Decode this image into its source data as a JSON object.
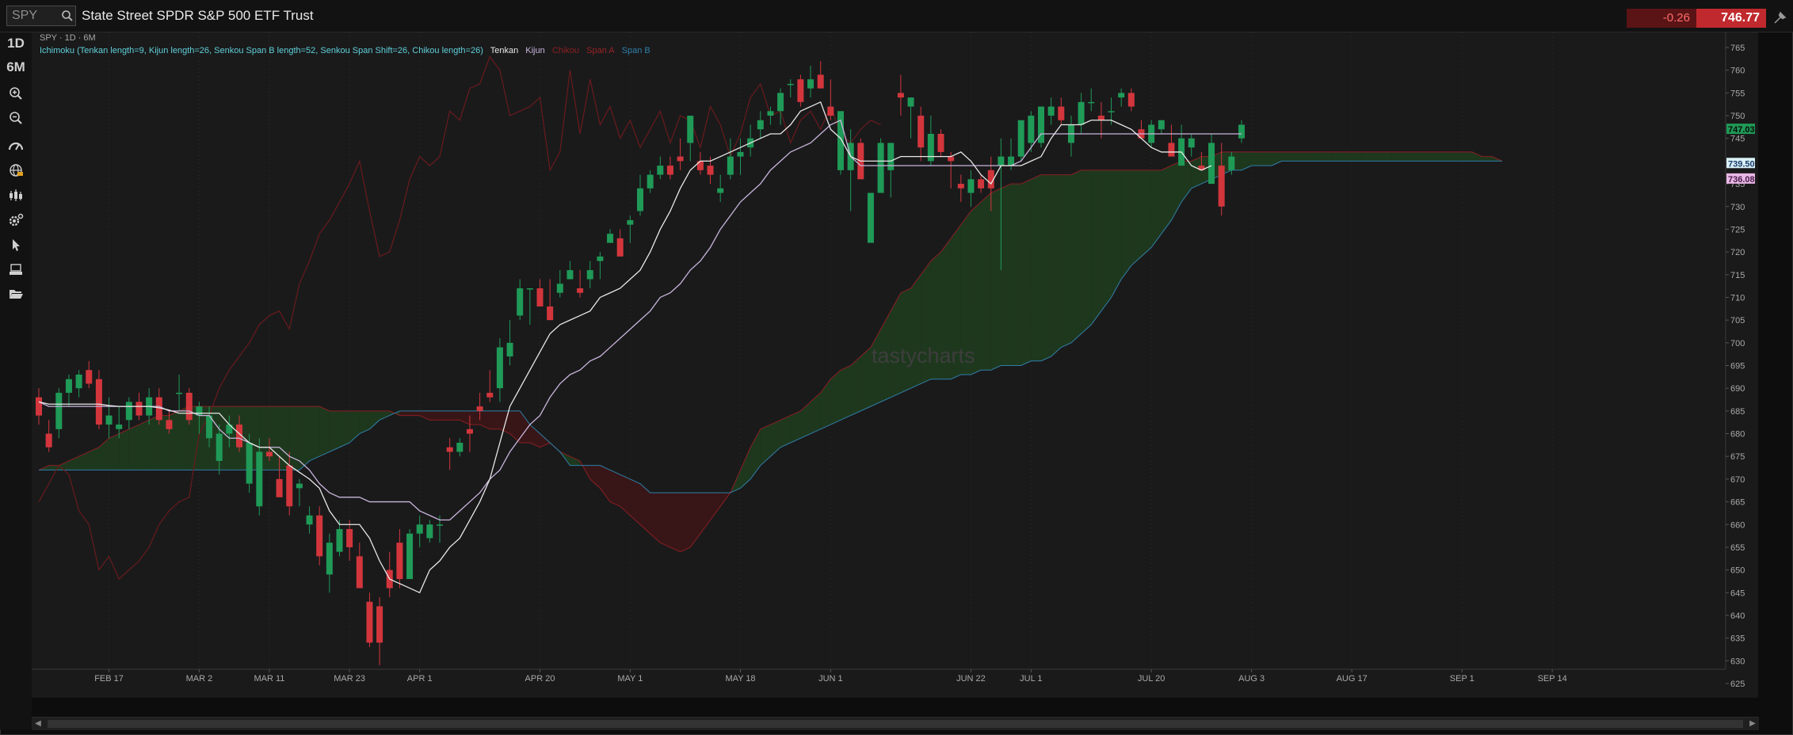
{
  "header": {
    "symbol_value": "SPY",
    "instrument_name": "State Street SPDR S&P 500 ETF Trust",
    "change": "-0.26",
    "last_price": "746.77",
    "search_icon": "search-icon",
    "pin_icon": "pin-icon"
  },
  "toolbar": {
    "interval": "1D",
    "range": "6M",
    "icons": [
      "zoom-in-icon",
      "zoom-out-icon",
      "speedometer-icon",
      "globe-icon",
      "candlestick-type-icon",
      "settings-icon",
      "cursor-icon",
      "drawing-tool-icon",
      "folder-open-icon"
    ]
  },
  "chart_info": "SPY · 1D · 6M",
  "legend": {
    "study": "Ichimoku (Tenkan length=9, Kijun length=26, Senkou Span B length=52, Senkou Span Shift=26, Chikou length=26)",
    "tenkan": "Tenkan",
    "kijun": "Kijun",
    "chikou": "Chikou",
    "span_a": "Span A",
    "span_b": "Span B"
  },
  "watermark": "tastycharts",
  "colors": {
    "up": "#1f9a57",
    "down": "#d2363c",
    "tenkan": "#e8e8e8",
    "kijun": "#c9b5dc",
    "chikou": "#6a1a1c",
    "span_a": "#8b1e22",
    "span_b": "#2f7fa8",
    "cloud_bull": "#1f3a1f",
    "cloud_bear": "#3a1617",
    "legend_study": "#5fd0d8"
  },
  "chart_data": {
    "type": "candlestick",
    "title": "SPY",
    "ylim": [
      622,
      767
    ],
    "y_ticks": [
      625,
      630,
      635,
      640,
      645,
      650,
      655,
      660,
      665,
      670,
      675,
      680,
      685,
      690,
      695,
      700,
      705,
      710,
      715,
      720,
      725,
      730,
      735,
      740,
      745,
      750,
      755,
      760,
      765
    ],
    "x_ticks": [
      {
        "label": "FEB 17",
        "index": 7
      },
      {
        "label": "MAR 2",
        "index": 16
      },
      {
        "label": "MAR 11",
        "index": 23
      },
      {
        "label": "MAR 23",
        "index": 31
      },
      {
        "label": "APR 1",
        "index": 38
      },
      {
        "label": "APR 20",
        "index": 50
      },
      {
        "label": "MAY 1",
        "index": 59
      },
      {
        "label": "MAY 18",
        "index": 70
      },
      {
        "label": "JUN 1",
        "index": 79
      },
      {
        "label": "JUN 22",
        "index": 93
      },
      {
        "label": "JUL 1",
        "index": 99
      },
      {
        "label": "JUL 20",
        "index": 111
      },
      {
        "label": "AUG 3",
        "index": 121
      },
      {
        "label": "AUG 17",
        "index": 131
      },
      {
        "label": "SEP 1",
        "index": 142
      },
      {
        "label": "SEP 14",
        "index": 151
      }
    ],
    "axis_badges": [
      {
        "value": "747.03",
        "price": 747.03,
        "color": "#1f9a57",
        "text_color": "#0a0a0a"
      },
      {
        "value": "739.50",
        "price": 739.5,
        "color": "#d9f0f5",
        "text_color": "#1a3c6a"
      },
      {
        "value": "736.08",
        "price": 736.08,
        "color": "#e9b8e6",
        "text_color": "#4a1a4a"
      }
    ],
    "candles": [
      [
        688,
        690,
        682,
        684
      ],
      [
        680,
        683,
        676,
        677
      ],
      [
        681,
        690,
        679,
        689
      ],
      [
        689,
        693,
        686,
        692
      ],
      [
        690,
        694,
        688,
        693
      ],
      [
        694,
        696,
        690,
        691
      ],
      [
        692,
        694,
        681,
        682
      ],
      [
        682,
        688,
        679,
        684
      ],
      [
        681,
        686,
        679,
        682
      ],
      [
        683,
        688,
        681,
        687
      ],
      [
        687,
        689,
        683,
        684
      ],
      [
        684,
        690,
        682,
        688
      ],
      [
        688,
        690,
        682,
        683
      ],
      [
        683,
        685,
        680,
        681
      ],
      [
        689,
        693,
        685,
        689
      ],
      [
        689,
        690,
        682,
        683
      ],
      [
        684,
        687,
        680,
        686
      ],
      [
        679,
        686,
        677,
        684
      ],
      [
        674,
        682,
        671,
        680
      ],
      [
        680,
        684,
        677,
        682
      ],
      [
        682,
        684,
        676,
        677
      ],
      [
        669,
        680,
        667,
        678
      ],
      [
        664,
        679,
        662,
        676
      ],
      [
        676,
        679,
        674,
        675
      ],
      [
        670,
        675,
        668,
        666
      ],
      [
        673,
        676,
        662,
        664
      ],
      [
        668,
        670,
        664,
        669
      ],
      [
        660,
        664,
        658,
        662
      ],
      [
        662,
        664,
        651,
        653
      ],
      [
        649,
        658,
        645,
        656
      ],
      [
        654,
        661,
        653,
        659
      ],
      [
        659,
        661,
        652,
        655
      ],
      [
        653,
        656,
        646,
        646
      ],
      [
        643,
        645,
        633,
        634
      ],
      [
        642,
        644,
        629,
        634
      ],
      [
        650,
        654,
        644,
        646
      ],
      [
        656,
        659,
        646,
        648
      ],
      [
        648,
        659,
        648,
        658
      ],
      [
        658,
        662,
        655,
        660
      ],
      [
        657,
        661,
        656,
        660
      ],
      [
        660,
        662,
        656,
        660
      ],
      [
        677,
        679,
        672,
        676
      ],
      [
        676,
        679,
        675,
        678
      ],
      [
        681,
        684,
        676,
        680
      ],
      [
        686,
        689,
        683,
        685
      ],
      [
        689,
        694,
        687,
        688
      ],
      [
        690,
        701,
        687,
        699
      ],
      [
        697,
        705,
        695,
        700
      ],
      [
        706,
        714,
        705,
        712
      ],
      [
        712,
        712,
        704,
        712
      ],
      [
        712,
        714,
        708,
        708
      ],
      [
        708,
        714,
        705,
        705
      ],
      [
        711,
        716,
        710,
        713
      ],
      [
        714,
        718,
        714,
        716
      ],
      [
        712,
        716,
        710,
        711
      ],
      [
        714,
        718,
        712,
        716
      ],
      [
        718,
        720,
        714,
        719
      ],
      [
        722,
        725,
        722,
        724
      ],
      [
        723,
        725,
        720,
        719
      ],
      [
        726,
        728,
        722,
        727
      ],
      [
        729,
        737,
        728,
        734
      ],
      [
        734,
        738,
        733,
        737
      ],
      [
        737,
        741,
        736,
        739
      ],
      [
        739,
        741,
        736,
        737
      ],
      [
        741,
        745,
        738,
        740
      ],
      [
        744,
        750,
        740,
        750
      ],
      [
        740,
        742,
        737,
        738
      ],
      [
        739,
        741,
        735,
        737
      ],
      [
        733,
        737,
        731,
        734
      ],
      [
        737,
        745,
        736,
        741
      ],
      [
        741,
        745,
        737,
        742
      ],
      [
        743,
        748,
        741,
        745
      ],
      [
        747,
        751,
        745,
        749
      ],
      [
        750,
        752,
        748,
        751
      ],
      [
        751,
        756,
        748,
        755
      ],
      [
        757,
        758,
        754,
        757
      ],
      [
        758,
        759,
        752,
        753
      ],
      [
        756,
        761,
        754,
        758
      ],
      [
        759,
        762,
        756,
        756
      ],
      [
        752,
        758,
        749,
        750
      ],
      [
        738,
        750,
        737,
        751
      ],
      [
        738,
        747,
        729,
        744
      ],
      [
        744,
        745,
        738,
        736
      ],
      [
        722,
        733,
        726,
        733
      ],
      [
        733,
        745,
        735,
        744
      ],
      [
        738,
        744,
        732,
        744
      ],
      [
        755,
        759,
        750,
        754
      ],
      [
        752,
        754,
        745,
        754
      ],
      [
        750,
        752,
        740,
        743
      ],
      [
        740,
        750,
        739,
        746
      ],
      [
        746,
        747,
        741,
        742
      ],
      [
        741,
        742,
        734,
        740
      ],
      [
        735,
        737,
        731,
        734
      ],
      [
        733,
        738,
        730,
        736
      ],
      [
        736,
        737,
        733,
        734
      ],
      [
        738,
        741,
        729,
        734
      ],
      [
        739,
        745,
        716,
        741
      ],
      [
        739,
        745,
        738,
        741
      ],
      [
        741,
        749,
        740,
        749
      ],
      [
        744,
        751,
        742,
        750
      ],
      [
        744,
        752,
        743,
        752
      ],
      [
        750,
        754,
        748,
        752
      ],
      [
        752,
        754,
        748,
        749
      ],
      [
        744,
        750,
        741,
        748
      ],
      [
        748,
        755,
        746,
        753
      ],
      [
        753,
        756,
        751,
        753
      ],
      [
        750,
        753,
        745,
        749
      ],
      [
        751,
        754,
        748,
        751
      ],
      [
        754,
        756,
        752,
        755
      ],
      [
        755,
        756,
        751,
        752
      ],
      [
        747,
        749,
        745,
        745
      ],
      [
        744,
        749,
        743,
        748
      ],
      [
        747,
        749,
        746,
        749
      ],
      [
        744,
        748,
        743,
        741
      ],
      [
        739,
        748,
        741,
        745
      ],
      [
        743,
        746,
        741,
        745
      ],
      [
        739,
        742,
        738,
        738
      ],
      [
        735,
        746,
        735,
        744
      ],
      [
        739,
        744,
        728,
        730
      ],
      [
        738,
        742,
        737,
        741
      ],
      [
        745,
        749,
        744,
        748
      ]
    ],
    "tenkan": [
      687,
      686.5,
      686.5,
      686.5,
      686.5,
      686.5,
      686.5,
      686.2,
      686,
      686,
      686,
      686,
      685.7,
      685.2,
      684.5,
      684.5,
      684.5,
      684.5,
      684.5,
      682,
      680,
      678,
      677,
      677,
      675,
      673,
      671.5,
      670,
      668,
      663,
      660,
      660,
      660,
      657,
      652,
      648,
      647,
      646,
      645,
      650,
      652,
      655,
      657,
      661,
      665,
      670,
      678,
      686,
      690,
      694,
      698,
      702,
      704,
      705,
      706,
      707,
      710,
      711,
      712,
      714,
      716,
      720,
      725,
      729,
      734,
      738,
      740,
      740,
      741,
      742,
      743,
      744,
      745,
      746,
      746,
      748,
      751,
      752,
      753,
      747,
      745,
      741,
      740,
      740,
      740,
      740,
      741,
      741,
      741,
      741,
      741,
      741,
      742,
      740,
      737,
      735,
      739,
      739,
      739,
      740,
      741,
      745,
      748,
      748,
      748,
      749,
      749,
      749,
      748,
      747,
      745,
      743,
      742,
      742,
      742,
      739,
      738,
      739
    ],
    "kijun": [
      687,
      686,
      686,
      686,
      686,
      686,
      686,
      686,
      686,
      686,
      686,
      686,
      686,
      685,
      685,
      685,
      684,
      684,
      681,
      679,
      679,
      678,
      677,
      677,
      677,
      675,
      674,
      672,
      669,
      667,
      666,
      666,
      666,
      665,
      665,
      665,
      665,
      665,
      663,
      662,
      661,
      661,
      663,
      665,
      667,
      670,
      672,
      676,
      679,
      682,
      684,
      688,
      691,
      693,
      694,
      696,
      697,
      699,
      701,
      703,
      705,
      707,
      710,
      711,
      713,
      716,
      718,
      721,
      725,
      728,
      731,
      733,
      735,
      738,
      740,
      742,
      743,
      744,
      746,
      748,
      749,
      741,
      739,
      739,
      739,
      739,
      739,
      739,
      739,
      739,
      739,
      739,
      739,
      739,
      739,
      739,
      739,
      739,
      740,
      743,
      746,
      746,
      746,
      746,
      746,
      746,
      746,
      746,
      746,
      746,
      746,
      746,
      746,
      746,
      746,
      746,
      746,
      746,
      746,
      746,
      746
    ],
    "chikou": [
      665,
      669,
      673,
      671,
      663,
      660,
      650,
      653,
      648,
      650,
      652,
      655,
      660,
      663,
      665,
      666,
      680,
      684,
      690,
      694,
      697,
      700,
      704,
      706,
      707,
      703,
      713,
      718,
      724,
      727,
      731,
      735,
      740,
      729,
      719,
      720,
      727,
      736,
      741,
      739,
      741,
      751,
      749,
      756,
      757,
      763,
      760,
      750,
      751,
      752,
      754,
      738,
      742,
      760,
      746,
      758,
      748,
      752,
      745,
      749,
      743,
      747,
      751,
      744,
      750,
      749,
      743,
      752,
      748,
      741,
      746,
      754,
      757,
      750,
      751,
      744,
      749,
      751,
      747,
      752,
      746,
      744,
      747,
      749,
      748
    ],
    "span_a": [
      672,
      673,
      673,
      674,
      675,
      676,
      677,
      679,
      680,
      681,
      682,
      683,
      684,
      684,
      685,
      686,
      686,
      686,
      686,
      686,
      686,
      686,
      686,
      686,
      686,
      686,
      686,
      686,
      686,
      685,
      685,
      685,
      685,
      685,
      685,
      685,
      684,
      684,
      684,
      683,
      683,
      683,
      683,
      682,
      682,
      681,
      681,
      680,
      678,
      678,
      677,
      678,
      676,
      675,
      674,
      670,
      668,
      665,
      664,
      662,
      660,
      658,
      656,
      655,
      654,
      655,
      658,
      661,
      664,
      667,
      672,
      677,
      681,
      682,
      683,
      684,
      685,
      687,
      689,
      692,
      694,
      695,
      697,
      699,
      703,
      707,
      711,
      712,
      715,
      718,
      720,
      723,
      726,
      729,
      731,
      733,
      734,
      735,
      735,
      736,
      737,
      737,
      737,
      737,
      738,
      738,
      738,
      738,
      738,
      738,
      738,
      738,
      738,
      739,
      740,
      740,
      741,
      741,
      742,
      742,
      742,
      742,
      742,
      742,
      742,
      742,
      742,
      742,
      742,
      742,
      742,
      742,
      742,
      742,
      742,
      742,
      742,
      742,
      742,
      742,
      742,
      742,
      742,
      742,
      741,
      741,
      740
    ],
    "span_b": [
      672,
      672,
      672,
      672,
      672,
      672,
      672,
      672,
      672,
      672,
      672,
      672,
      672,
      672,
      672,
      672,
      672,
      672,
      672,
      672,
      672,
      672,
      672,
      672,
      672,
      672,
      672,
      674,
      675,
      676,
      677,
      678,
      680,
      681,
      683,
      684,
      685,
      685,
      685,
      685,
      685,
      685,
      685,
      685,
      685,
      685,
      685,
      685,
      685,
      682,
      680,
      678,
      676,
      673,
      673,
      673,
      673,
      672,
      671,
      670,
      669,
      667,
      667,
      667,
      667,
      667,
      667,
      667,
      667,
      667,
      668,
      670,
      673,
      675,
      677,
      678,
      679,
      680,
      681,
      682,
      683,
      684,
      685,
      686,
      687,
      688,
      689,
      690,
      691,
      692,
      692,
      692,
      693,
      693,
      694,
      694,
      695,
      695,
      695,
      696,
      696,
      697,
      699,
      700,
      702,
      704,
      707,
      710,
      714,
      717,
      719,
      721,
      724,
      727,
      731,
      734,
      735,
      736,
      737,
      738,
      738,
      739,
      739,
      739,
      740,
      740,
      740,
      740,
      740,
      740,
      740,
      740,
      740,
      740,
      740,
      740,
      740,
      740,
      740,
      740,
      740,
      740,
      740,
      740,
      740,
      740,
      740
    ]
  }
}
